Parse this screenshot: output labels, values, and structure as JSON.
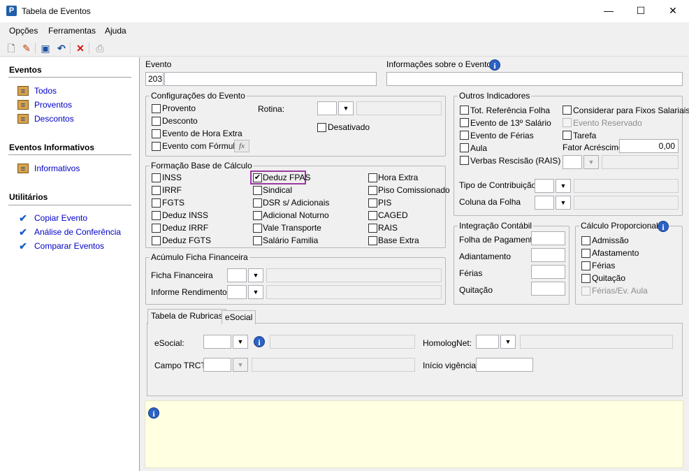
{
  "window": {
    "title": "Tabela de Eventos",
    "min": "—",
    "max": "☐",
    "close": "✕"
  },
  "menu": {
    "opcoes": "Opções",
    "ferramentas": "Ferramentas",
    "ajuda": "Ajuda"
  },
  "sidebar": {
    "eventos_title": "Eventos",
    "eventos": [
      "Todos",
      "Proventos",
      "Descontos"
    ],
    "informativos_title": "Eventos Informativos",
    "informativos": [
      "Informativos"
    ],
    "utilitarios_title": "Utilitários",
    "utilitarios": [
      "Copiar Evento",
      "Análise de Conferência",
      "Comparar Eventos"
    ]
  },
  "evento": {
    "label": "Evento",
    "code": "203",
    "name": ""
  },
  "info_evento": {
    "label": "Informações sobre o Evento",
    "value": ""
  },
  "config": {
    "title": "Configurações do Evento",
    "provento": "Provento",
    "desconto": "Desconto",
    "hora_extra": "Evento de Hora Extra",
    "formula": "Evento com Fórmula",
    "fx": "fx",
    "rotina": "Rotina:",
    "desativado": "Desativado"
  },
  "outros": {
    "title": "Outros Indicadores",
    "ref_folha": "Tot. Referência Folha",
    "fixos": "Considerar para Fixos Salariais",
    "decimo": "Evento de 13º Salário",
    "reservado": "Evento Reservado",
    "ferias": "Evento de Férias",
    "tarefa": "Tarefa",
    "aula": "Aula",
    "fator": "Fator Acréscimo",
    "fator_value": "0,00",
    "rescisao": "Verbas Rescisão (RAIS)",
    "tipo_contrib": "Tipo de Contribuição",
    "coluna_folha": "Coluna da Folha"
  },
  "formacao": {
    "title": "Formação Base de Cálculo",
    "col1": [
      "INSS",
      "IRRF",
      "FGTS",
      "Deduz INSS",
      "Deduz IRRF",
      "Deduz FGTS"
    ],
    "col2": [
      "Deduz FPAS",
      "Sindical",
      "DSR s/ Adicionais",
      "Adicional Noturno",
      "Vale Transporte",
      "Salário Familia"
    ],
    "col3": [
      "Hora Extra",
      "Piso Comissionado",
      "PIS",
      "CAGED",
      "RAIS",
      "Base Extra"
    ]
  },
  "acumulo": {
    "title": "Acúmulo Ficha Financeira",
    "ficha": "Ficha Financeira",
    "informe": "Informe Rendimentos"
  },
  "integracao": {
    "title": "Integração Contábil",
    "folha": "Folha de Pagamento",
    "adiantamento": "Adiantamento",
    "ferias": "Férias",
    "quitacao": "Quitação"
  },
  "proporcional": {
    "title": "Cálculo Proporcional",
    "items": [
      "Admissão",
      "Afastamento",
      "Férias",
      "Quitação",
      "Férias/Ev. Aula"
    ]
  },
  "tabs": {
    "rubricas": "Tabela de Rubricas",
    "esocial": "eSocial"
  },
  "rubricas": {
    "esocial": "eSocial:",
    "homolognet": "HomologNet:",
    "trct": "Campo TRCT:",
    "inicio": "Início vigência:"
  },
  "colors": {
    "accent": "#2b62c6",
    "highlight": "#9b3aa0",
    "link": "#0000c8",
    "infobox": "#ffffe1"
  }
}
